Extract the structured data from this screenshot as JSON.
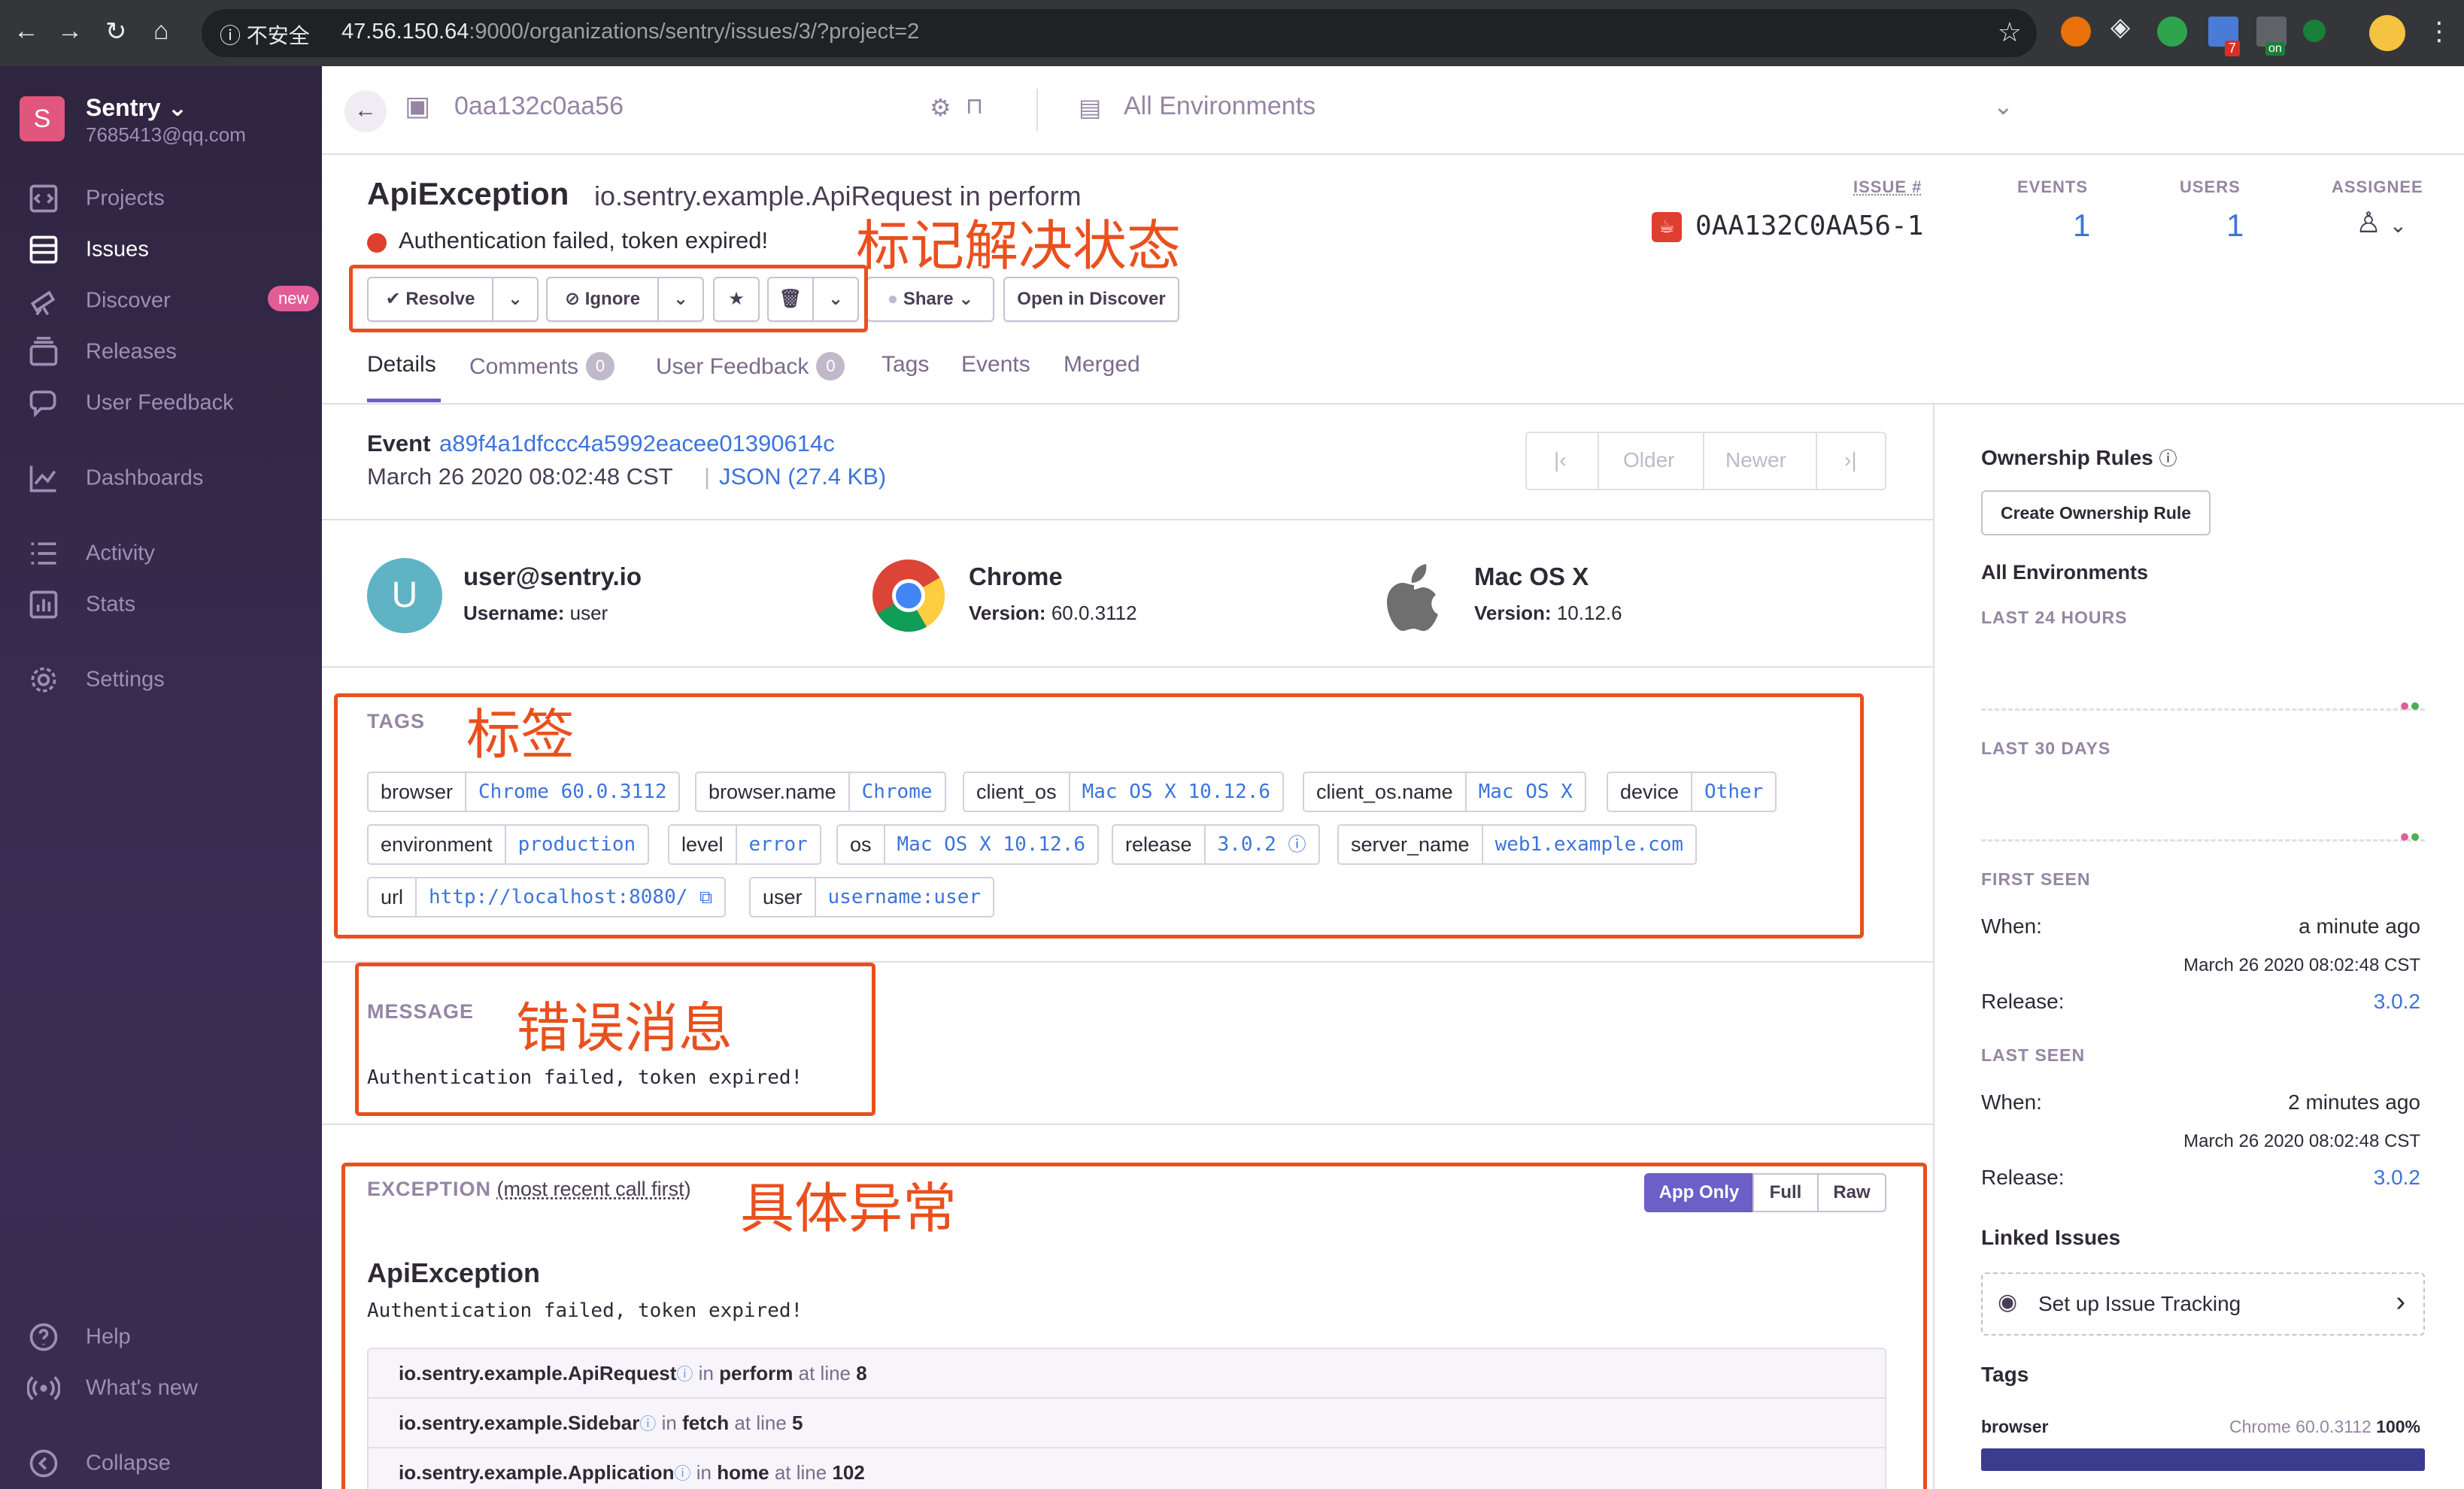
{
  "browser": {
    "insecure_label": "不安全",
    "url_host": "47.56.150.64",
    "url_rest": ":9000/organizations/sentry/issues/3/?project=2",
    "ext_badge_count": "7",
    "ext_on_label": "on"
  },
  "sidebar": {
    "org_initial": "S",
    "org_name": "Sentry ⌄",
    "org_email": "7685413@qq.com",
    "items": [
      {
        "label": "Projects"
      },
      {
        "label": "Issues"
      },
      {
        "label": "Discover",
        "badge": "new"
      },
      {
        "label": "Releases"
      },
      {
        "label": "User Feedback"
      },
      {
        "label": "Dashboards"
      },
      {
        "label": "Activity"
      },
      {
        "label": "Stats"
      },
      {
        "label": "Settings"
      }
    ],
    "bottom": [
      {
        "label": "Help"
      },
      {
        "label": "What's new"
      },
      {
        "label": "Collapse"
      }
    ]
  },
  "header": {
    "short_id": "0aa132c0aa56",
    "environment": "All Environments"
  },
  "issue": {
    "title": "ApiException",
    "culprit": "io.sentry.example.ApiRequest in perform",
    "message": "Authentication failed, token expired!",
    "stats": {
      "issue_label": "ISSUE #",
      "issue_value": "0AA132C0AA56-1",
      "events_label": "EVENTS",
      "events_value": "1",
      "users_label": "USERS",
      "users_value": "1",
      "assignee_label": "ASSIGNEE"
    },
    "actions": {
      "resolve": "Resolve",
      "ignore": "Ignore",
      "share": "Share",
      "open_discover": "Open in Discover"
    }
  },
  "tabs": [
    {
      "label": "Details"
    },
    {
      "label": "Comments",
      "count": "0"
    },
    {
      "label": "User Feedback",
      "count": "0"
    },
    {
      "label": "Tags"
    },
    {
      "label": "Events"
    },
    {
      "label": "Merged"
    }
  ],
  "event": {
    "label": "Event",
    "id": "a89f4a1dfccc4a5992eacee01390614c",
    "date": "March 26 2020 08:02:48 CST",
    "separator": "|",
    "json_link": "JSON (27.4 KB)",
    "pager": {
      "older": "Older",
      "newer": "Newer"
    }
  },
  "context": {
    "user": {
      "initial": "U",
      "title": "user@sentry.io",
      "sub_label": "Username:",
      "sub_value": "user"
    },
    "browser": {
      "title": "Chrome",
      "sub_label": "Version:",
      "sub_value": "60.0.3112"
    },
    "os": {
      "title": "Mac OS X",
      "sub_label": "Version:",
      "sub_value": "10.12.6"
    }
  },
  "tags_section": {
    "header": "TAGS",
    "tags": [
      {
        "k": "browser",
        "v": "Chrome 60.0.3112"
      },
      {
        "k": "browser.name",
        "v": "Chrome"
      },
      {
        "k": "client_os",
        "v": "Mac OS X 10.12.6"
      },
      {
        "k": "client_os.name",
        "v": "Mac OS X"
      },
      {
        "k": "device",
        "v": "Other"
      },
      {
        "k": "environment",
        "v": "production"
      },
      {
        "k": "level",
        "v": "error"
      },
      {
        "k": "os",
        "v": "Mac OS X 10.12.6"
      },
      {
        "k": "release",
        "v": "3.0.2"
      },
      {
        "k": "server_name",
        "v": "web1.example.com"
      },
      {
        "k": "url",
        "v": "http://localhost:8080/"
      },
      {
        "k": "user",
        "v": "username:user"
      }
    ]
  },
  "message_section": {
    "header": "MESSAGE",
    "body": "Authentication failed, token expired!"
  },
  "exception_section": {
    "header": "EXCEPTION",
    "header_note": "(most recent call first)",
    "toggle": [
      "App Only",
      "Full",
      "Raw"
    ],
    "type": "ApiException",
    "value": "Authentication failed, token expired!",
    "frames": [
      {
        "module": "io.sentry.example.ApiRequest",
        "in": "in",
        "func": "perform",
        "at": "at line",
        "line": "8"
      },
      {
        "module": "io.sentry.example.Sidebar",
        "in": "in",
        "func": "fetch",
        "at": "at line",
        "line": "5"
      },
      {
        "module": "io.sentry.example.Application",
        "in": "in",
        "func": "home",
        "at": "at line",
        "line": "102"
      }
    ]
  },
  "annotations": {
    "status": "标记解决状态",
    "tags": "标签",
    "message": "错误消息",
    "exception": "具体异常"
  },
  "right_panel": {
    "ownership_title": "Ownership Rules",
    "create_rule": "Create Ownership Rule",
    "env_title": "All Environments",
    "last24": "LAST 24 HOURS",
    "last30": "LAST 30 DAYS",
    "first_seen": {
      "header": "FIRST SEEN",
      "when_label": "When:",
      "when_value": "a minute ago",
      "date": "March 26 2020 08:02:48 CST",
      "release_label": "Release:",
      "release_value": "3.0.2"
    },
    "last_seen": {
      "header": "LAST SEEN",
      "when_label": "When:",
      "when_value": "2 minutes ago",
      "date": "March 26 2020 08:02:48 CST",
      "release_label": "Release:",
      "release_value": "3.0.2"
    },
    "linked_title": "Linked Issues",
    "setup_tracking": "Set up Issue Tracking",
    "tags_title": "Tags",
    "tag_browser_label": "browser",
    "tag_browser_value": "Chrome 60.0.3112",
    "tag_browser_pct": "100%"
  },
  "colors": {
    "accent": "#6c5fc7",
    "link": "#3d74db",
    "annotation": "#e9501e",
    "error": "#e03e2f"
  }
}
